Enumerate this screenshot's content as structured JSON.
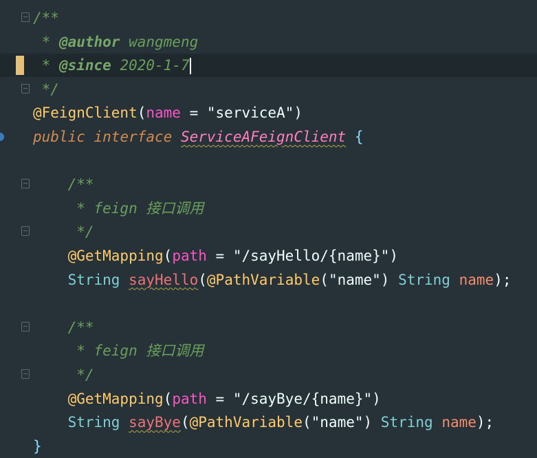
{
  "editor": {
    "lines": [
      {
        "parts": [
          {
            "t": "/**",
            "c": "c-comment"
          }
        ]
      },
      {
        "parts": [
          {
            "t": " * ",
            "c": "c-comment"
          },
          {
            "t": "@author",
            "c": "c-tag"
          },
          {
            "t": " wangmeng",
            "c": "c-comment"
          }
        ]
      },
      {
        "parts": [
          {
            "t": " * ",
            "c": "c-comment"
          },
          {
            "t": "@since",
            "c": "c-tag"
          },
          {
            "t": " 2020-1-7",
            "c": "c-comment"
          }
        ]
      },
      {
        "parts": [
          {
            "t": " */",
            "c": "c-comment"
          }
        ]
      },
      {
        "parts": [
          {
            "t": "@FeignClient",
            "c": "c-annot"
          },
          {
            "t": "(",
            "c": "c-plain"
          },
          {
            "t": "name",
            "c": "c-param"
          },
          {
            "t": " = ",
            "c": "c-plain"
          },
          {
            "t": "\"serviceA\"",
            "c": "c-str"
          },
          {
            "t": ")",
            "c": "c-plain"
          }
        ]
      },
      {
        "parts": [
          {
            "t": "public",
            "c": "c-kw"
          },
          {
            "t": " ",
            "c": "c-plain"
          },
          {
            "t": "interface",
            "c": "c-kw"
          },
          {
            "t": " ",
            "c": "c-plain"
          },
          {
            "t": "ServiceAFeignClient",
            "c": "c-iface squiggle"
          },
          {
            "t": " {",
            "c": "c-punc"
          }
        ]
      },
      {
        "parts": []
      },
      {
        "parts": [
          {
            "t": "    /**",
            "c": "c-comment"
          }
        ]
      },
      {
        "parts": [
          {
            "t": "     * feign 接口调用",
            "c": "c-comment"
          }
        ]
      },
      {
        "parts": [
          {
            "t": "     */",
            "c": "c-comment"
          }
        ]
      },
      {
        "parts": [
          {
            "t": "    ",
            "c": "c-plain"
          },
          {
            "t": "@GetMapping",
            "c": "c-annot"
          },
          {
            "t": "(",
            "c": "c-plain"
          },
          {
            "t": "path",
            "c": "c-param"
          },
          {
            "t": " = ",
            "c": "c-plain"
          },
          {
            "t": "\"/sayHello/{name}\"",
            "c": "c-str"
          },
          {
            "t": ")",
            "c": "c-plain"
          }
        ]
      },
      {
        "parts": [
          {
            "t": "    ",
            "c": "c-plain"
          },
          {
            "t": "String",
            "c": "c-type"
          },
          {
            "t": " ",
            "c": "c-plain"
          },
          {
            "t": "sayHello",
            "c": "c-method squiggle"
          },
          {
            "t": "(",
            "c": "c-plain"
          },
          {
            "t": "@PathVariable",
            "c": "c-annot"
          },
          {
            "t": "(",
            "c": "c-plain"
          },
          {
            "t": "\"name\"",
            "c": "c-str"
          },
          {
            "t": ") ",
            "c": "c-plain"
          },
          {
            "t": "String",
            "c": "c-type"
          },
          {
            "t": " ",
            "c": "c-plain"
          },
          {
            "t": "name",
            "c": "c-var"
          },
          {
            "t": ");",
            "c": "c-plain"
          }
        ]
      },
      {
        "parts": []
      },
      {
        "parts": [
          {
            "t": "    /**",
            "c": "c-comment"
          }
        ]
      },
      {
        "parts": [
          {
            "t": "     * feign 接口调用",
            "c": "c-comment"
          }
        ]
      },
      {
        "parts": [
          {
            "t": "     */",
            "c": "c-comment"
          }
        ]
      },
      {
        "parts": [
          {
            "t": "    ",
            "c": "c-plain"
          },
          {
            "t": "@GetMapping",
            "c": "c-annot"
          },
          {
            "t": "(",
            "c": "c-plain"
          },
          {
            "t": "path",
            "c": "c-param"
          },
          {
            "t": " = ",
            "c": "c-plain"
          },
          {
            "t": "\"/sayBye/{name}\"",
            "c": "c-str"
          },
          {
            "t": ")",
            "c": "c-plain"
          }
        ]
      },
      {
        "parts": [
          {
            "t": "    ",
            "c": "c-plain"
          },
          {
            "t": "String",
            "c": "c-type"
          },
          {
            "t": " ",
            "c": "c-plain"
          },
          {
            "t": "sayBye",
            "c": "c-method squiggle"
          },
          {
            "t": "(",
            "c": "c-plain"
          },
          {
            "t": "@PathVariable",
            "c": "c-annot"
          },
          {
            "t": "(",
            "c": "c-plain"
          },
          {
            "t": "\"name\"",
            "c": "c-str"
          },
          {
            "t": ") ",
            "c": "c-plain"
          },
          {
            "t": "String",
            "c": "c-type"
          },
          {
            "t": " ",
            "c": "c-plain"
          },
          {
            "t": "name",
            "c": "c-var"
          },
          {
            "t": ");",
            "c": "c-plain"
          }
        ]
      },
      {
        "parts": [
          {
            "t": "}",
            "c": "c-punc"
          }
        ]
      }
    ],
    "fold_markers": [
      {
        "line": 0,
        "kind": "open"
      },
      {
        "line": 3,
        "kind": "close"
      },
      {
        "line": 7,
        "kind": "open"
      },
      {
        "line": 9,
        "kind": "close"
      },
      {
        "line": 13,
        "kind": "open"
      },
      {
        "line": 15,
        "kind": "close"
      }
    ],
    "current_line": 2,
    "changed_line": 2,
    "bookmark_line": 5
  }
}
